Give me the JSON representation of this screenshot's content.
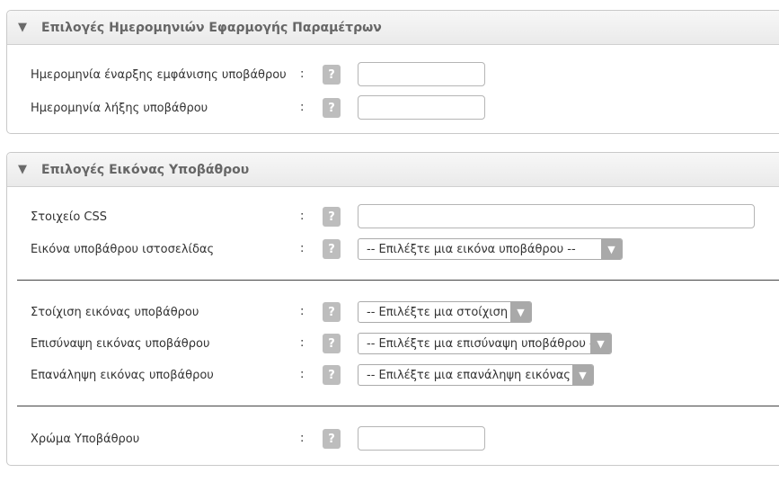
{
  "dates_panel": {
    "title": "Επιλογές Ημερομηνιών Εφαρμογής Παραμέτρων",
    "rows": [
      {
        "label": "Ημερομηνία έναρξης εμφάνισης υποβάθρου",
        "colon": ":",
        "help": "?",
        "value": ""
      },
      {
        "label": "Ημερομηνία λήξης υποβάθρου",
        "colon": ":",
        "help": "?",
        "value": ""
      }
    ]
  },
  "image_panel": {
    "title": "Επιλογές Εικόνας Υποβάθρου",
    "css_element": {
      "label": "Στοιχείο CSS",
      "colon": ":",
      "help": "?",
      "value": ""
    },
    "background_image": {
      "label": "Εικόνα υποβάθρου ιστοσελίδας",
      "colon": ":",
      "help": "?",
      "selected": "-- Επιλέξτε μια εικόνα υποβάθρου --"
    },
    "alignment": {
      "label": "Στοίχιση εικόνας υποβάθρου",
      "colon": ":",
      "help": "?",
      "selected": "-- Επιλέξτε μια στοίχιση --"
    },
    "attachment": {
      "label": "Επισύναψη εικόνας υποβάθρου",
      "colon": ":",
      "help": "?",
      "selected": "-- Επιλέξτε μια επισύναψη υποβάθρου --"
    },
    "repeat": {
      "label": "Επανάληψη εικόνας υποβάθρου",
      "colon": ":",
      "help": "?",
      "selected": "-- Επιλέξτε μια επανάληψη εικόνας --"
    },
    "color": {
      "label": "Χρώμα Υποβάθρου",
      "colon": ":",
      "help": "?",
      "value": ""
    }
  },
  "icons": {
    "collapse": "triangle-down-icon",
    "help": "question-mark-icon",
    "dropdown": "chevron-down-icon"
  }
}
